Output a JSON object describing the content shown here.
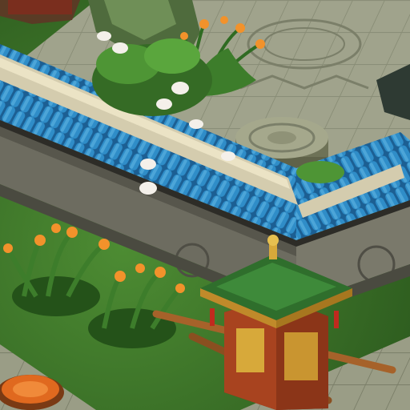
{
  "scene": {
    "type": "isometric-garden-courtyard",
    "palette": {
      "grass": "#3f7a2a",
      "grass_dark": "#2c5a1e",
      "paving": "#9a9d86",
      "paving_line": "#7b7f69",
      "wall": "#8c8b7c",
      "wall_shadow": "#5e5e52",
      "wall_cap": "#c9c2a6",
      "roof_tile": "#1f6fa8",
      "roof_tile_light": "#2f8dc8",
      "sedan_body": "#a8431f",
      "sedan_roof": "#3e8a3a",
      "gold": "#d7a93a",
      "flower_orange": "#f2922b",
      "magnolia": "#f4f0ea"
    },
    "objects": [
      {
        "name": "courtyard-wall-with-blue-tile-roof"
      },
      {
        "name": "stone-paved-terrace"
      },
      {
        "name": "round-stone-drum-table"
      },
      {
        "name": "white-magnolia-shrub"
      },
      {
        "name": "orange-lily-flower-clump"
      },
      {
        "name": "red-sedan-chair-palanquin"
      },
      {
        "name": "orange-round-stepping-stone"
      },
      {
        "name": "rocky-cliff-corner"
      }
    ]
  }
}
